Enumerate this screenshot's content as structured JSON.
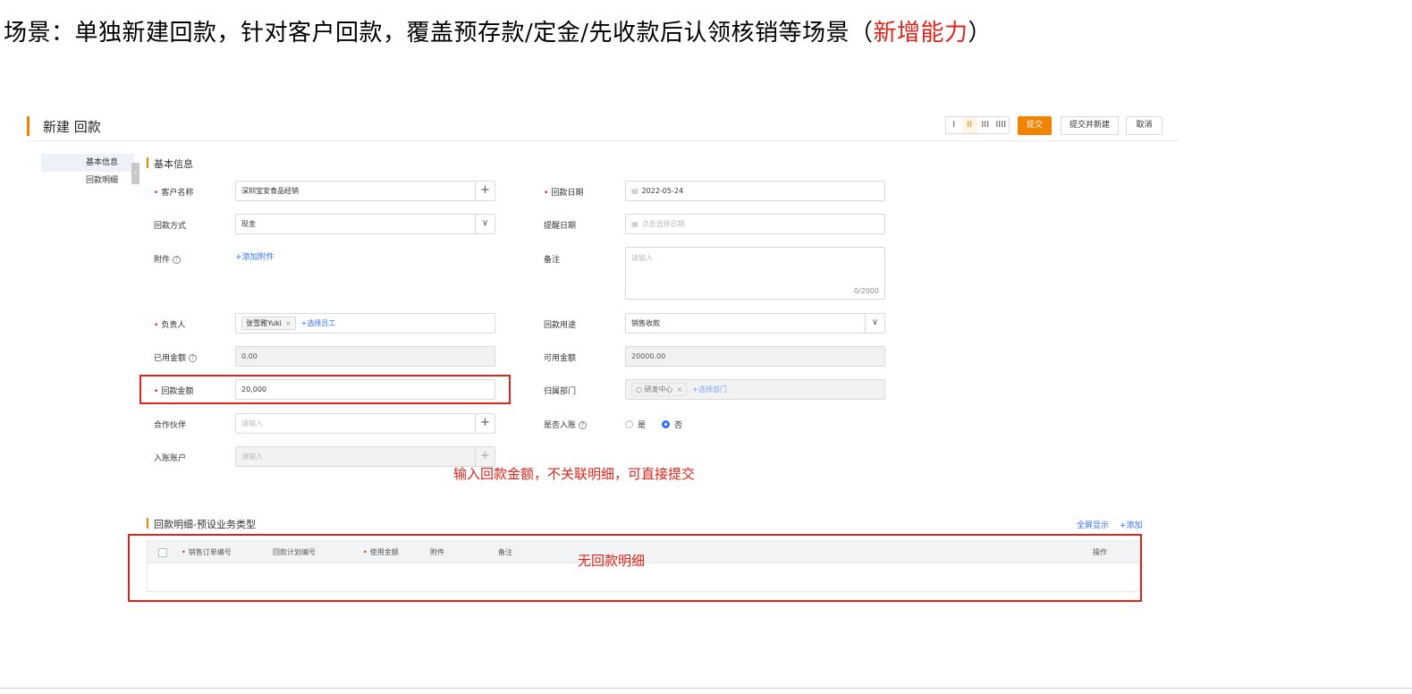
{
  "scenario": {
    "text": "场景：单独新建回款，针对客户回款，覆盖预存款/定金/先收款后认领核销等场景（",
    "highlight": "新增能力",
    "close": "）",
    "highlight_color": "#e2231a"
  },
  "header": {
    "title": "新建 回款",
    "layout_options": [
      "I",
      "II",
      "III",
      "IIII"
    ],
    "submit_label": "提交",
    "submit_new_label": "提交并新建",
    "cancel_label": "取消",
    "accent_color": "#f08300"
  },
  "side_nav": {
    "items": [
      {
        "label": "基本信息",
        "active": true
      },
      {
        "label": "回款明细",
        "active": false
      }
    ],
    "collapse_icon": "chevron-left-icon"
  },
  "basic_info": {
    "title": "基本信息",
    "customer": {
      "label": "客户名称",
      "value": "深圳宝安食品经销"
    },
    "payment_date": {
      "label": "回款日期",
      "value": "2022-05-24"
    },
    "payment_method": {
      "label": "回款方式",
      "value": "现金"
    },
    "reminder_date": {
      "label": "提醒日期",
      "placeholder": "点击选择日期"
    },
    "attachment": {
      "label": "附件",
      "action": "+添加附件"
    },
    "remark": {
      "label": "备注",
      "placeholder": "请输入",
      "counter": "0/2000"
    },
    "owner": {
      "label": "负责人",
      "tag": "张雪雅Yuki",
      "action": "+选择员工"
    },
    "purpose": {
      "label": "回款用途",
      "value": "销售收款"
    },
    "used_amount": {
      "label": "已用金额",
      "value": "0.00"
    },
    "available_amount": {
      "label": "可用金额",
      "value": "20000.00"
    },
    "amount": {
      "label": "回款金额",
      "value": "20,000"
    },
    "department": {
      "label": "归属部门",
      "tag": "研发中心",
      "action": "+选择部门"
    },
    "partner": {
      "label": "合作伙伴",
      "placeholder": "请输入"
    },
    "posted": {
      "label": "是否入账",
      "options": [
        "是",
        "否"
      ],
      "selected": "否"
    },
    "account": {
      "label": "入账账户",
      "placeholder": "请输入"
    }
  },
  "annotations": {
    "amount_note": "输入回款金额，不关联明细，可直接提交",
    "detail_note": "无回款明细",
    "color": "#e2231a"
  },
  "detail": {
    "title": "回款明细-预设业务类型",
    "fullscreen_label": "全屏显示",
    "add_label": "+添加",
    "columns": [
      {
        "label": "销售订单编号",
        "required": true
      },
      {
        "label": "回款计划编号",
        "required": false
      },
      {
        "label": "使用金额",
        "required": true
      },
      {
        "label": "附件",
        "required": false
      },
      {
        "label": "备注",
        "required": false
      },
      {
        "label": "操作",
        "required": false
      }
    ]
  }
}
